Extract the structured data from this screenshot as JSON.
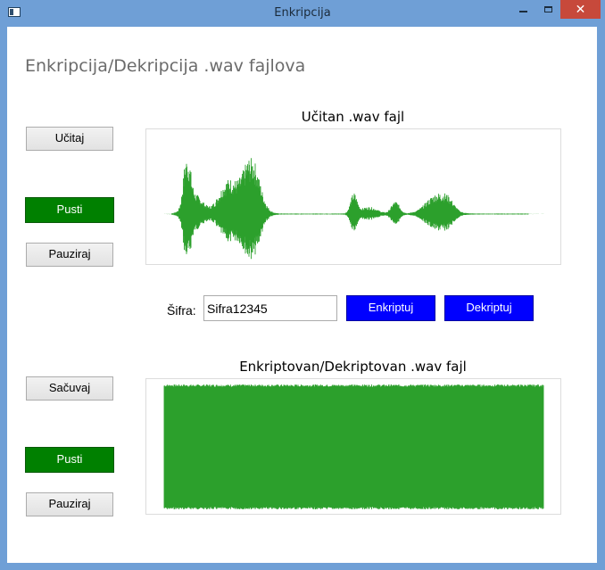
{
  "window": {
    "title": "Enkripcija",
    "close_glyph": "✕"
  },
  "header": {
    "title": "Enkripcija/Dekripcija .wav fajlova"
  },
  "loaded": {
    "load_label": "Učitaj",
    "play_label": "Pusti",
    "pause_label": "Pauziraj",
    "plot_title": "Učitan .wav fajl",
    "waveform_color": "#2ca02c"
  },
  "cipher": {
    "label": "Šifra:",
    "value": "Sifra12345",
    "encrypt_label": "Enkriptuj",
    "decrypt_label": "Dekriptuj"
  },
  "result": {
    "save_label": "Sačuvaj",
    "play_label": "Pusti",
    "pause_label": "Pauziraj",
    "plot_title": "Enkriptovan/Dekriptovan .wav fajl",
    "waveform_color": "#2ca02c"
  },
  "colors": {
    "play_button": "#008000",
    "action_button": "#0000ff",
    "titlebar": "#6f9fd6",
    "close_button": "#c7493b"
  },
  "icons": [
    "app-icon",
    "minimize-icon",
    "maximize-icon",
    "close-icon"
  ]
}
